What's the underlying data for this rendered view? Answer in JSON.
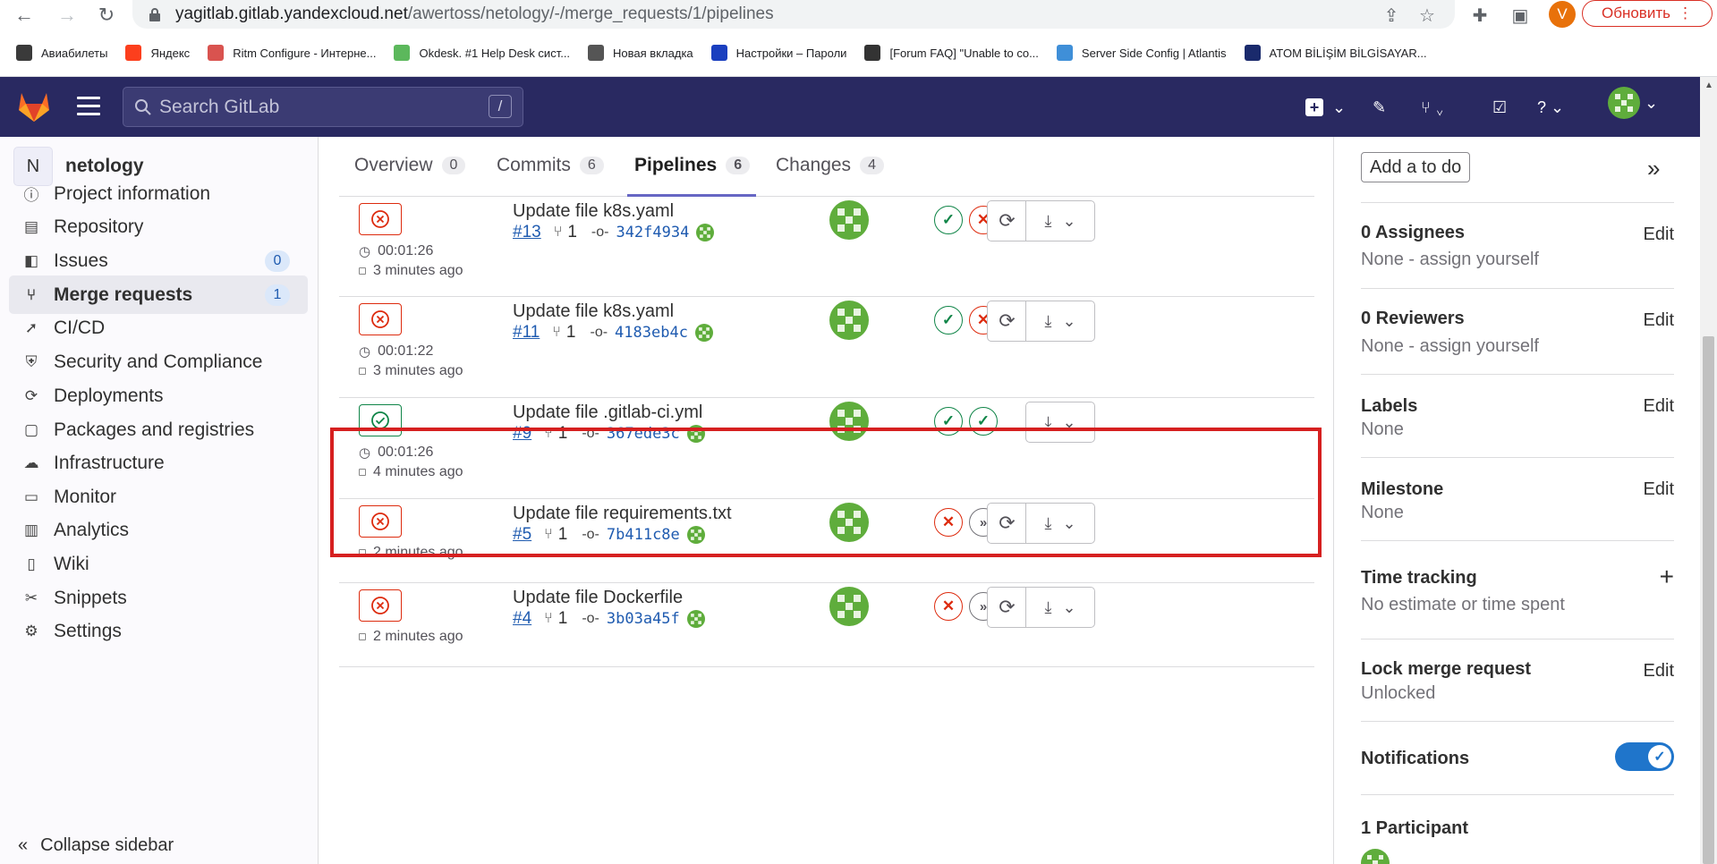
{
  "browser": {
    "url_host": "yagitlab.gitlab.yandexcloud.net",
    "url_path": "/awertoss/netology/-/merge_requests/1/pipelines",
    "profile_initial": "V",
    "update_label": "Обновить",
    "bookmarks": [
      {
        "label": "Авиабилеты",
        "color": "#3a3a3a"
      },
      {
        "label": "Яндекс",
        "color": "#fc3f1d"
      },
      {
        "label": "Ritm Configure - Интерне...",
        "color": "#d9534f"
      },
      {
        "label": "Okdesk. #1 Help Desk сист...",
        "color": "#5cb85c"
      },
      {
        "label": "Новая вкладка",
        "color": "#555555"
      },
      {
        "label": "Настройки – Пароли",
        "color": "#1a3fbf"
      },
      {
        "label": "[Forum FAQ] \"Unable to co...",
        "color": "#333333"
      },
      {
        "label": "Server Side Config | Atlantis",
        "color": "#3f8fd8"
      },
      {
        "label": "ATOM BİLİŞİM BİLGİSAYAR...",
        "color": "#1a2a6c"
      }
    ]
  },
  "header": {
    "search_placeholder": "Search GitLab",
    "search_shortcut": "/"
  },
  "sidebar": {
    "project_initial": "N",
    "project_name": "netology",
    "items": [
      {
        "label": "Project information",
        "icon": "info-icon"
      },
      {
        "label": "Repository",
        "icon": "repository-icon"
      },
      {
        "label": "Issues",
        "icon": "issues-icon",
        "badge": "0"
      },
      {
        "label": "Merge requests",
        "icon": "merge-request-icon",
        "badge": "1"
      },
      {
        "label": "CI/CD",
        "icon": "rocket-icon"
      },
      {
        "label": "Security and Compliance",
        "icon": "shield-icon"
      },
      {
        "label": "Deployments",
        "icon": "deployments-icon"
      },
      {
        "label": "Packages and registries",
        "icon": "package-icon"
      },
      {
        "label": "Infrastructure",
        "icon": "cloud-icon"
      },
      {
        "label": "Monitor",
        "icon": "monitor-icon"
      },
      {
        "label": "Analytics",
        "icon": "chart-icon"
      },
      {
        "label": "Wiki",
        "icon": "book-icon"
      },
      {
        "label": "Snippets",
        "icon": "snippet-icon"
      },
      {
        "label": "Settings",
        "icon": "gear-icon"
      }
    ],
    "collapse_label": "Collapse sidebar"
  },
  "tabs": [
    {
      "label": "Overview",
      "count": "0"
    },
    {
      "label": "Commits",
      "count": "6"
    },
    {
      "label": "Pipelines",
      "count": "6"
    },
    {
      "label": "Changes",
      "count": "4"
    }
  ],
  "pipelines": [
    {
      "status": "failed",
      "duration": "00:01:26",
      "ago": "3 minutes ago",
      "title": "Update file k8s.yaml",
      "id": "#13",
      "branches": "1",
      "sha": "342f4934",
      "stages": [
        "ok",
        "fail"
      ],
      "retry": true
    },
    {
      "status": "failed",
      "duration": "00:01:22",
      "ago": "3 minutes ago",
      "title": "Update file k8s.yaml",
      "id": "#11",
      "branches": "1",
      "sha": "4183eb4c",
      "stages": [
        "ok",
        "fail"
      ],
      "retry": true
    },
    {
      "status": "passed",
      "duration": "00:01:26",
      "ago": "4 minutes ago",
      "title": "Update file .gitlab-ci.yml",
      "id": "#9",
      "branches": "1",
      "sha": "367ede3c",
      "stages": [
        "ok",
        "ok"
      ],
      "retry": false
    },
    {
      "status": "failed",
      "duration": "",
      "ago": "2 minutes ago",
      "title": "Update file requirements.txt",
      "id": "#5",
      "branches": "1",
      "sha": "7b411c8e",
      "stages": [
        "fail",
        "skip"
      ],
      "retry": true
    },
    {
      "status": "failed",
      "duration": "",
      "ago": "2 minutes ago",
      "title": "Update file Dockerfile",
      "id": "#4",
      "branches": "1",
      "sha": "3b03a45f",
      "stages": [
        "fail",
        "skip"
      ],
      "retry": true
    }
  ],
  "right_sidebar": {
    "todo_label": "Add a to do",
    "assignees_title": "0 Assignees",
    "assignees_value": "None - assign yourself",
    "reviewers_title": "0 Reviewers",
    "reviewers_value": "None - assign yourself",
    "labels_title": "Labels",
    "labels_value": "None",
    "milestone_title": "Milestone",
    "milestone_value": "None",
    "time_title": "Time tracking",
    "time_value": "No estimate or time spent",
    "lock_title": "Lock merge request",
    "lock_value": "Unlocked",
    "notifications_title": "Notifications",
    "participants_title": "1 Participant",
    "edit_label": "Edit"
  },
  "colors": {
    "gitlab_header": "#292961",
    "failed": "#dd2b0e",
    "passed": "#108548",
    "link": "#1f5bb0",
    "highlight": "#d62020"
  }
}
